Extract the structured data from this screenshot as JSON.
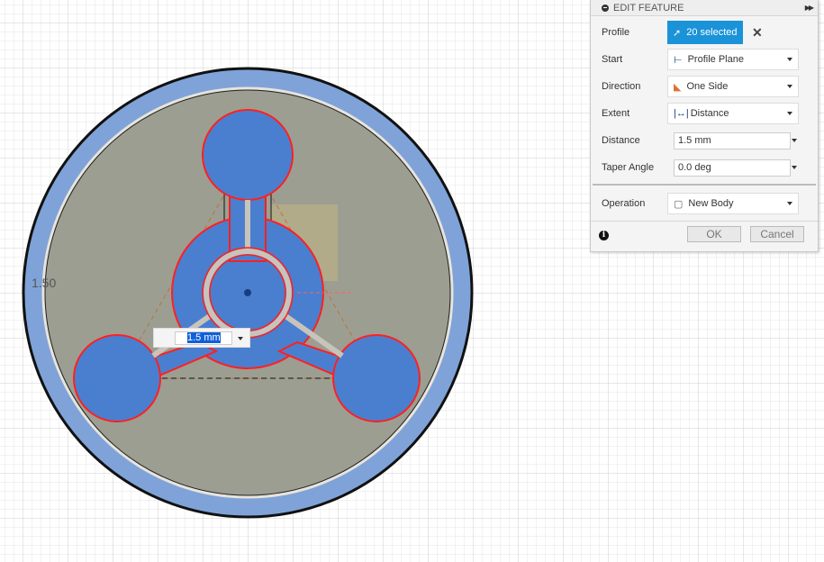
{
  "panel": {
    "title": "EDIT FEATURE",
    "profile_label": "Profile",
    "profile_value": "20 selected",
    "start_label": "Start",
    "start_value": "Profile Plane",
    "direction_label": "Direction",
    "direction_value": "One Side",
    "extent_label": "Extent",
    "extent_value": "Distance",
    "distance_label": "Distance",
    "distance_value": "1.5 mm",
    "taper_label": "Taper Angle",
    "taper_value": "0.0 deg",
    "operation_label": "Operation",
    "operation_value": "New Body",
    "ok_label": "OK",
    "cancel_label": "Cancel"
  },
  "canvas": {
    "dimension_input": "1.5 mm",
    "sketch_dimension": "1.50"
  },
  "colors": {
    "accent": "#1a93d8",
    "profile_fill": "#4a7fcf",
    "profile_outline": "#ff2020",
    "body_ring": "#7fa3d8",
    "disc": "#9c9e92"
  }
}
